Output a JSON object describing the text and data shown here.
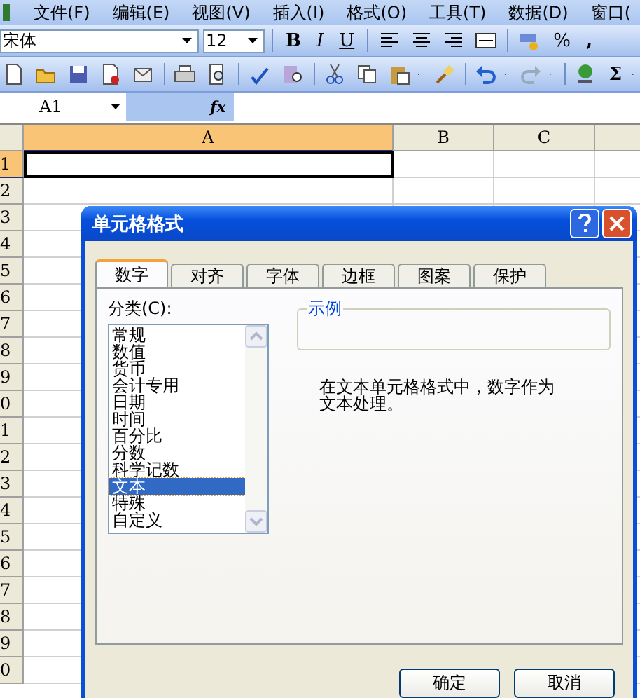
{
  "menu_bar": {
    "items": [
      "文件(F)",
      "编辑(E)",
      "视图(V)",
      "插入(I)",
      "格式(O)",
      "工具(T)",
      "数据(D)",
      "窗口("
    ]
  },
  "formatting_toolbar": {
    "font": "宋体",
    "size": "12",
    "bold": "B",
    "italic": "I",
    "underline": "U",
    "percent": "%",
    "comma": ","
  },
  "standard_toolbar": {
    "sum": "Σ"
  },
  "formula_bar": {
    "name_box": "A1",
    "fx": "fx"
  },
  "sheet": {
    "columns": [
      {
        "label": "A",
        "selected": true
      },
      {
        "label": "B",
        "selected": false
      },
      {
        "label": "C",
        "selected": false
      }
    ],
    "rows": [
      {
        "label": "1",
        "selected": true
      },
      {
        "label": "2",
        "selected": false
      },
      {
        "label": "3",
        "selected": false
      },
      {
        "label": "4",
        "selected": false
      },
      {
        "label": "5",
        "selected": false
      },
      {
        "label": "6",
        "selected": false
      },
      {
        "label": "7",
        "selected": false
      },
      {
        "label": "8",
        "selected": false
      },
      {
        "label": "9",
        "selected": false
      },
      {
        "label": "0",
        "selected": false
      },
      {
        "label": "1",
        "selected": false
      },
      {
        "label": "2",
        "selected": false
      },
      {
        "label": "3",
        "selected": false
      },
      {
        "label": "4",
        "selected": false
      },
      {
        "label": "5",
        "selected": false
      },
      {
        "label": "6",
        "selected": false
      },
      {
        "label": "7",
        "selected": false
      },
      {
        "label": "8",
        "selected": false
      },
      {
        "label": "9",
        "selected": false
      },
      {
        "label": "0",
        "selected": false
      }
    ]
  },
  "dialog": {
    "title": "单元格格式",
    "tabs": [
      {
        "label": "数字",
        "selected": true
      },
      {
        "label": "对齐",
        "selected": false
      },
      {
        "label": "字体",
        "selected": false
      },
      {
        "label": "边框",
        "selected": false
      },
      {
        "label": "图案",
        "selected": false
      },
      {
        "label": "保护",
        "selected": false
      }
    ],
    "category_label": "分类(C):",
    "categories": [
      {
        "label": "常规",
        "selected": false
      },
      {
        "label": "数值",
        "selected": false
      },
      {
        "label": "货币",
        "selected": false
      },
      {
        "label": "会计专用",
        "selected": false
      },
      {
        "label": "日期",
        "selected": false
      },
      {
        "label": "时间",
        "selected": false
      },
      {
        "label": "百分比",
        "selected": false
      },
      {
        "label": "分数",
        "selected": false
      },
      {
        "label": "科学记数",
        "selected": false
      },
      {
        "label": "文本",
        "selected": true
      },
      {
        "label": "特殊",
        "selected": false
      },
      {
        "label": "自定义",
        "selected": false
      }
    ],
    "sample_label": "示例",
    "description": "在文本单元格格式中，数字作为文本处理。",
    "buttons": [
      "确定",
      "取消"
    ]
  }
}
